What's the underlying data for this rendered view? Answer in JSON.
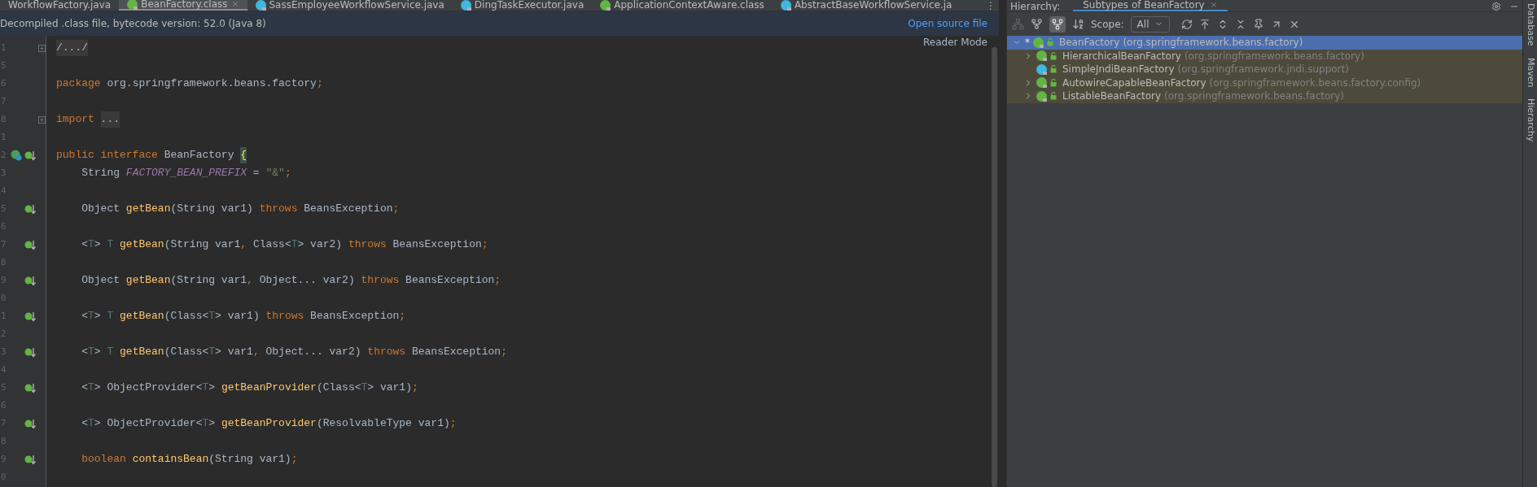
{
  "editor_tabs": [
    {
      "label": "WorkflowFactory.java",
      "kind": "plain",
      "selected": false,
      "closable": false
    },
    {
      "label": "BeanFactory.class",
      "kind": "interface",
      "selected": true,
      "closable": true
    },
    {
      "label": "SassEmployeeWorkflowService.java",
      "kind": "class",
      "selected": false,
      "closable": false
    },
    {
      "label": "DingTaskExecutor.java",
      "kind": "class",
      "selected": false,
      "closable": false
    },
    {
      "label": "ApplicationContextAware.class",
      "kind": "interface",
      "selected": false,
      "closable": false
    },
    {
      "label": "AbstractBaseWorkflowService.ja",
      "kind": "class",
      "selected": false,
      "closable": false
    }
  ],
  "more_tabs": "⋮",
  "banner": {
    "message": "Decompiled .class file, bytecode version: 52.0 (Java 8)",
    "link": "Open source file"
  },
  "reader_mode": "Reader Mode",
  "code_lines": [
    {
      "number": "1",
      "kind": "fold",
      "tokens": [
        {
          "kind": "folded",
          "text": "/.../"
        }
      ]
    },
    {
      "number": "5",
      "kind": "plain"
    },
    {
      "number": "6",
      "kind": "plain",
      "tokens": [
        {
          "kind": "keyword",
          "text": "package "
        },
        {
          "kind": "plain",
          "text": "org.springframework.beans.factory"
        },
        {
          "kind": "keyword",
          "text": ";"
        }
      ]
    },
    {
      "number": "7",
      "kind": "plain"
    },
    {
      "number": "8",
      "kind": "fold",
      "tokens": [
        {
          "kind": "keyword",
          "text": "import "
        },
        {
          "kind": "folded",
          "text": "..."
        }
      ]
    },
    {
      "number": "1",
      "kind": "plain"
    },
    {
      "number": "2",
      "kind": "class",
      "tokens": [
        {
          "kind": "keyword",
          "text": "public interface "
        },
        {
          "kind": "plain",
          "text": "BeanFactory "
        },
        {
          "kind": "brace",
          "text": "{"
        }
      ]
    },
    {
      "number": "3",
      "kind": "plain",
      "tokens": [
        {
          "kind": "plain",
          "text": "    String "
        },
        {
          "kind": "constant",
          "text": "FACTORY_BEAN_PREFIX"
        },
        {
          "kind": "plain",
          "text": " = "
        },
        {
          "kind": "string",
          "text": "\"&\""
        },
        {
          "kind": "keyword",
          "text": ";"
        }
      ]
    },
    {
      "number": "4",
      "kind": "plain"
    },
    {
      "number": "5",
      "kind": "method",
      "tokens": [
        {
          "kind": "plain",
          "text": "    Object "
        },
        {
          "kind": "method",
          "text": "getBean"
        },
        {
          "kind": "plain",
          "text": "(String var1) "
        },
        {
          "kind": "keyword",
          "text": "throws "
        },
        {
          "kind": "plain",
          "text": "BeansException"
        },
        {
          "kind": "keyword",
          "text": ";"
        }
      ]
    },
    {
      "number": "6",
      "kind": "plain"
    },
    {
      "number": "7",
      "kind": "method",
      "tokens": [
        {
          "kind": "plain",
          "text": "    <"
        },
        {
          "kind": "typeparam",
          "text": "T"
        },
        {
          "kind": "plain",
          "text": "> "
        },
        {
          "kind": "typeparam",
          "text": "T "
        },
        {
          "kind": "method",
          "text": "getBean"
        },
        {
          "kind": "plain",
          "text": "(String var1"
        },
        {
          "kind": "keyword",
          "text": ", "
        },
        {
          "kind": "plain",
          "text": "Class<"
        },
        {
          "kind": "typeparam",
          "text": "T"
        },
        {
          "kind": "plain",
          "text": "> var2) "
        },
        {
          "kind": "keyword",
          "text": "throws "
        },
        {
          "kind": "plain",
          "text": "BeansException"
        },
        {
          "kind": "keyword",
          "text": ";"
        }
      ]
    },
    {
      "number": "8",
      "kind": "plain"
    },
    {
      "number": "9",
      "kind": "method",
      "tokens": [
        {
          "kind": "plain",
          "text": "    Object "
        },
        {
          "kind": "method",
          "text": "getBean"
        },
        {
          "kind": "plain",
          "text": "(String var1"
        },
        {
          "kind": "keyword",
          "text": ", "
        },
        {
          "kind": "plain",
          "text": "Object... var2) "
        },
        {
          "kind": "keyword",
          "text": "throws "
        },
        {
          "kind": "plain",
          "text": "BeansException"
        },
        {
          "kind": "keyword",
          "text": ";"
        }
      ]
    },
    {
      "number": "0",
      "kind": "plain"
    },
    {
      "number": "1",
      "kind": "method",
      "tokens": [
        {
          "kind": "plain",
          "text": "    <"
        },
        {
          "kind": "typeparam",
          "text": "T"
        },
        {
          "kind": "plain",
          "text": "> "
        },
        {
          "kind": "typeparam",
          "text": "T "
        },
        {
          "kind": "method",
          "text": "getBean"
        },
        {
          "kind": "plain",
          "text": "(Class<"
        },
        {
          "kind": "typeparam",
          "text": "T"
        },
        {
          "kind": "plain",
          "text": "> var1) "
        },
        {
          "kind": "keyword",
          "text": "throws "
        },
        {
          "kind": "plain",
          "text": "BeansException"
        },
        {
          "kind": "keyword",
          "text": ";"
        }
      ]
    },
    {
      "number": "2",
      "kind": "plain"
    },
    {
      "number": "3",
      "kind": "method",
      "tokens": [
        {
          "kind": "plain",
          "text": "    <"
        },
        {
          "kind": "typeparam",
          "text": "T"
        },
        {
          "kind": "plain",
          "text": "> "
        },
        {
          "kind": "typeparam",
          "text": "T "
        },
        {
          "kind": "method",
          "text": "getBean"
        },
        {
          "kind": "plain",
          "text": "(Class<"
        },
        {
          "kind": "typeparam",
          "text": "T"
        },
        {
          "kind": "plain",
          "text": "> var1"
        },
        {
          "kind": "keyword",
          "text": ", "
        },
        {
          "kind": "plain",
          "text": "Object... var2) "
        },
        {
          "kind": "keyword",
          "text": "throws "
        },
        {
          "kind": "plain",
          "text": "BeansException"
        },
        {
          "kind": "keyword",
          "text": ";"
        }
      ]
    },
    {
      "number": "4",
      "kind": "plain"
    },
    {
      "number": "5",
      "kind": "method",
      "tokens": [
        {
          "kind": "plain",
          "text": "    <"
        },
        {
          "kind": "typeparam",
          "text": "T"
        },
        {
          "kind": "plain",
          "text": "> ObjectProvider<"
        },
        {
          "kind": "typeparam",
          "text": "T"
        },
        {
          "kind": "plain",
          "text": "> "
        },
        {
          "kind": "method",
          "text": "getBeanProvider"
        },
        {
          "kind": "plain",
          "text": "(Class<"
        },
        {
          "kind": "typeparam",
          "text": "T"
        },
        {
          "kind": "plain",
          "text": "> var1)"
        },
        {
          "kind": "keyword",
          "text": ";"
        }
      ]
    },
    {
      "number": "6",
      "kind": "plain"
    },
    {
      "number": "7",
      "kind": "method",
      "tokens": [
        {
          "kind": "plain",
          "text": "    <"
        },
        {
          "kind": "typeparam",
          "text": "T"
        },
        {
          "kind": "plain",
          "text": "> ObjectProvider<"
        },
        {
          "kind": "typeparam",
          "text": "T"
        },
        {
          "kind": "plain",
          "text": "> "
        },
        {
          "kind": "method",
          "text": "getBeanProvider"
        },
        {
          "kind": "plain",
          "text": "(ResolvableType var1)"
        },
        {
          "kind": "keyword",
          "text": ";"
        }
      ]
    },
    {
      "number": "8",
      "kind": "plain"
    },
    {
      "number": "9",
      "kind": "method",
      "tokens": [
        {
          "kind": "keyword",
          "text": "    boolean "
        },
        {
          "kind": "method",
          "text": "containsBean"
        },
        {
          "kind": "plain",
          "text": "(String var1)"
        },
        {
          "kind": "keyword",
          "text": ";"
        }
      ]
    },
    {
      "number": "0",
      "kind": "plain"
    }
  ],
  "hierarchy": {
    "label": "Hierarchy:",
    "tab": {
      "label": "Subtypes of BeanFactory",
      "selected": true
    },
    "scope_label": "Scope:",
    "scope_value": "All",
    "tree": [
      {
        "marker": "*",
        "name": "BeanFactory",
        "package": "(org.springframework.beans.factory)",
        "kind": "interface",
        "selected": true,
        "expanded": true,
        "children": [
          {
            "name": "HierarchicalBeanFactory",
            "package": "(org.springframework.beans.factory)",
            "kind": "interface",
            "selected": false,
            "expanded": false
          },
          {
            "name": "SimpleJndiBeanFactory",
            "package": "(org.springframework.jndi.support)",
            "kind": "class",
            "selected": false
          },
          {
            "name": "AutowireCapableBeanFactory",
            "package": "(org.springframework.beans.factory.config)",
            "kind": "interface",
            "selected": false,
            "expanded": false
          },
          {
            "name": "ListableBeanFactory",
            "package": "(org.springframework.beans.factory)",
            "kind": "interface",
            "selected": false,
            "expanded": false
          }
        ]
      }
    ]
  },
  "side_tools": [
    "Database",
    "Maven",
    "Hierarchy"
  ]
}
